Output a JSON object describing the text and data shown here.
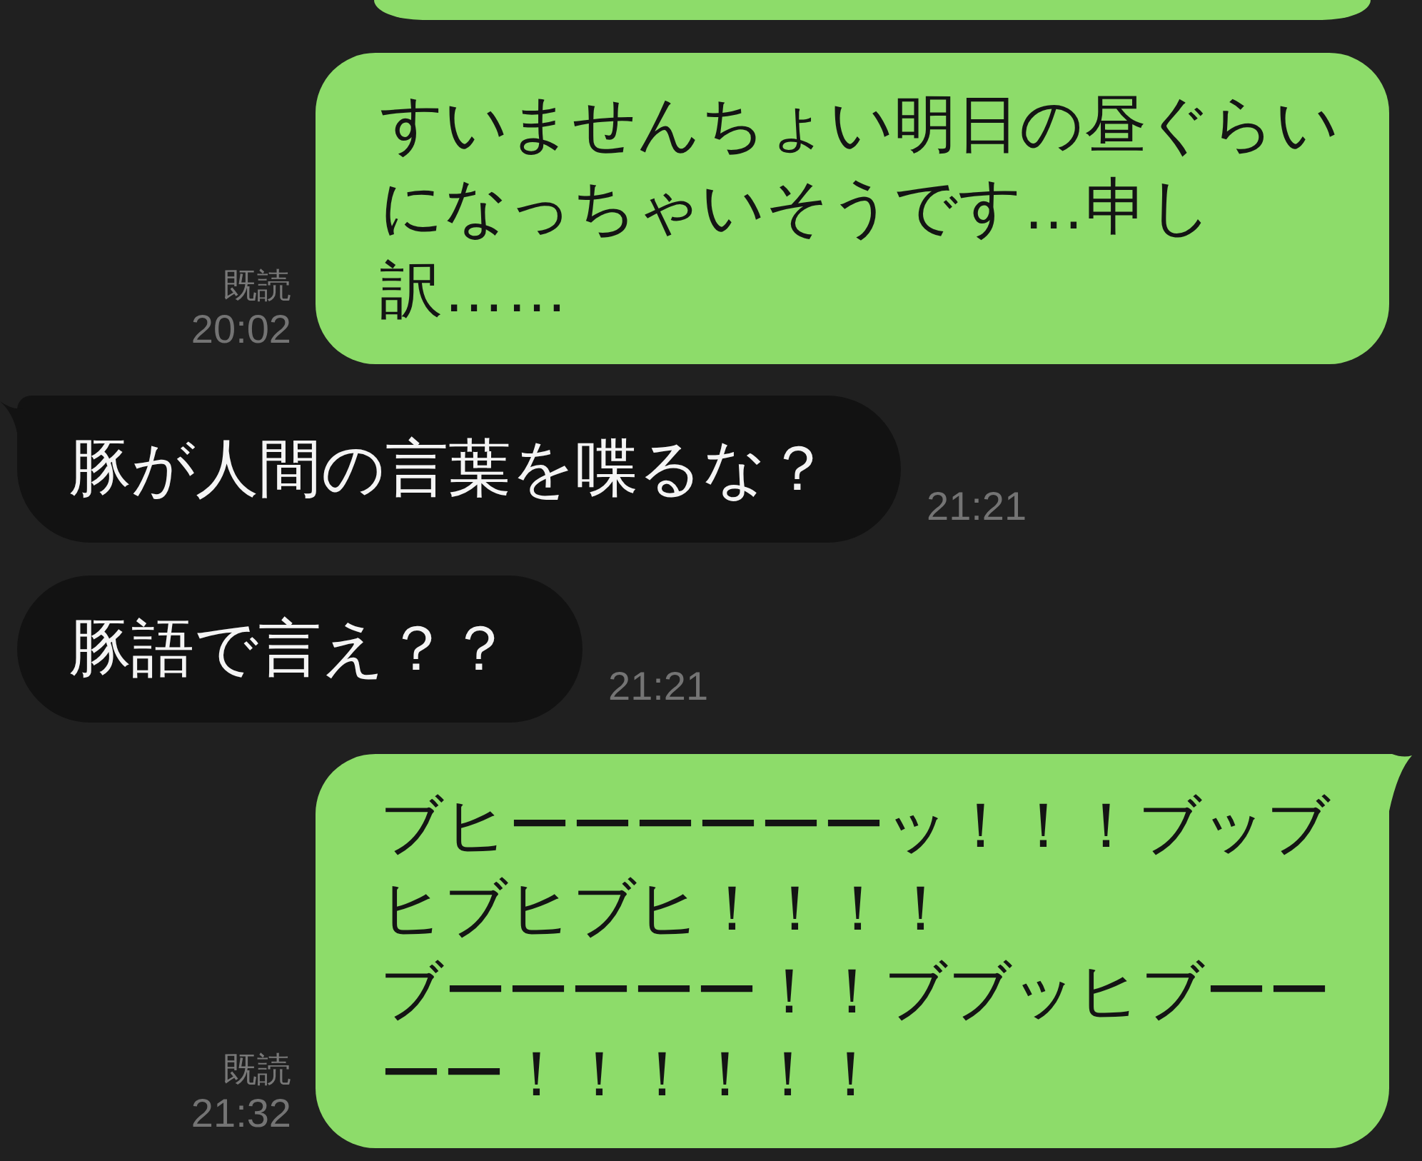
{
  "scrolled_bubble": {
    "kind": "sent"
  },
  "messages": [
    {
      "kind": "sent",
      "paragraphs": [
        "すいませんちょい明日の昼ぐらいになっちゃいそうです…申し訳……"
      ],
      "read_label": "既読",
      "time": "20:02",
      "tail": false
    },
    {
      "kind": "received",
      "paragraphs": [
        "豚が人間の言葉を喋るな？"
      ],
      "time": "21:21",
      "tail": true
    },
    {
      "kind": "received",
      "paragraphs": [
        "豚語で言え？？"
      ],
      "time": "21:21",
      "tail": false
    },
    {
      "kind": "sent",
      "paragraphs": [
        "ブヒーーーーーーッ！！！ブッブヒブヒブヒ！！！！",
        "ブーーーーー！！ブブッヒブーーーー！！！！！！"
      ],
      "read_label": "既読",
      "time": "21:32",
      "tail": true
    }
  ]
}
